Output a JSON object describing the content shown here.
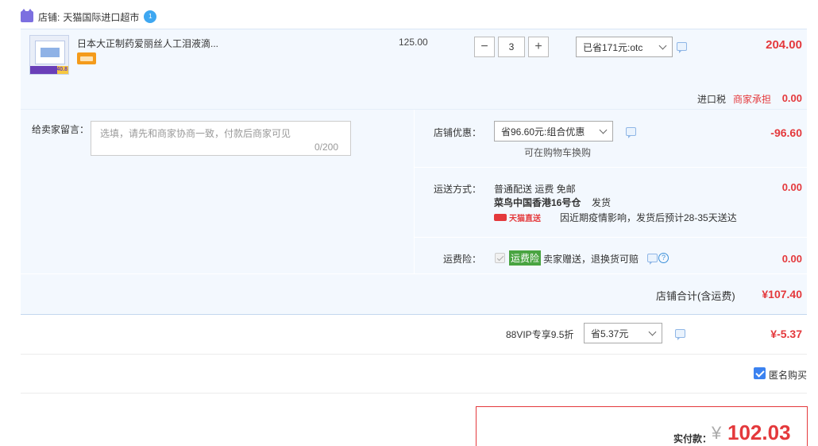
{
  "shop": {
    "label": "店铺:",
    "name": "天猫国际进口超市",
    "wangwang": "1"
  },
  "product": {
    "title": "日本大正制药爱丽丝人工泪液滴...",
    "thumb_price_tag": "40.8",
    "unit_price": "125.00",
    "quantity": "3",
    "discount_select": "已省171元:otc",
    "subtotal": "204.00",
    "import_tax_label": "进口税",
    "import_tax_note": "商家承担",
    "import_tax_value": "0.00"
  },
  "message": {
    "label": "给卖家留言：",
    "placeholder": "选填，请先和商家协商一致，付款后商家可见",
    "count": "0/200"
  },
  "shop_coupon": {
    "label": "店铺优惠：",
    "select": "省96.60元:组合优惠",
    "note": "可在购物车换购",
    "value": "-96.60"
  },
  "shipping": {
    "label": "运送方式：",
    "method": "普通配送 运费 免邮",
    "warehouse": "菜鸟中国香港16号仓",
    "ship_word": "发货",
    "tmall_direct": "天猫直送",
    "delay_note": "因近期疫情影响，发货后预计28-35天送达",
    "value": "0.00"
  },
  "insurance": {
    "label": "运费险：",
    "badge": "运费险",
    "desc": "卖家赠送，退换货可赔",
    "value": "0.00"
  },
  "shop_total": {
    "label": "店铺合计(含运费)",
    "value": "¥107.40"
  },
  "vip": {
    "label": "88VIP专享9.5折",
    "select": "省5.37元",
    "value": "¥-5.37"
  },
  "anonymous": {
    "label": "匿名购买",
    "checked": true
  },
  "payment": {
    "label": "实付款：",
    "currency": "¥",
    "value": "102.03"
  },
  "colors": {
    "accent_red": "#e4393c",
    "panel_bg": "#f3f8fe",
    "check_blue": "#3b82f0",
    "insurance_green": "#49a441"
  }
}
